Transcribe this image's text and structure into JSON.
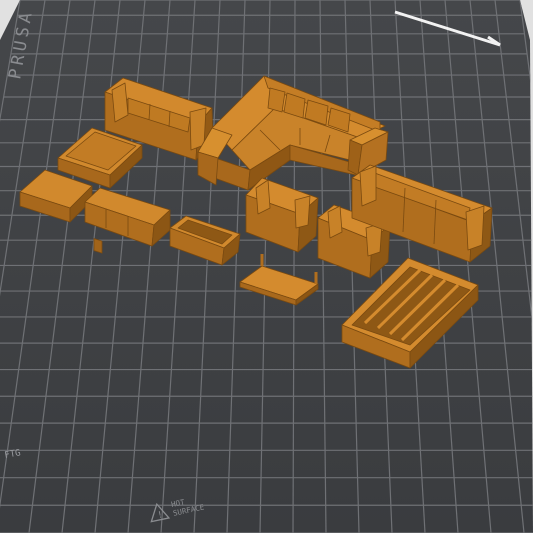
{
  "viewport": {
    "bed": {
      "color": "#3d3f42",
      "grid_color": "#6f7175",
      "logo_text": "PRUSA",
      "corner_marker": "FTG",
      "warning_text": [
        "HOT",
        "SURFACE"
      ]
    },
    "model_color": "#c07a22",
    "objects": [
      "three-seat-sofa",
      "corner-sectional-sofa",
      "coffee-table",
      "ottoman",
      "tv-console-cabinet",
      "planter-box",
      "armchair-left",
      "armchair-right",
      "long-sofa",
      "side-table",
      "bookshelf"
    ]
  }
}
